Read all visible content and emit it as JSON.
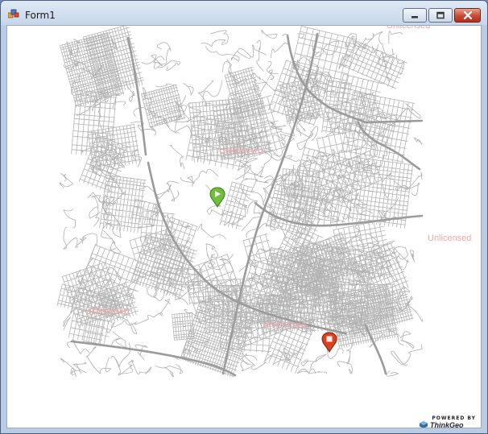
{
  "window": {
    "title": "Form1",
    "controls": {
      "minimize": "minimize",
      "maximize": "maximize",
      "close": "close"
    }
  },
  "map": {
    "watermark_text": "Unlicensed",
    "markers": [
      {
        "name": "start-marker",
        "color": "#6fbf3a",
        "icon": "play-flag-icon"
      },
      {
        "name": "end-marker",
        "color": "#d9421e",
        "icon": "stop-square-icon"
      }
    ],
    "road_color": "#a9a9a9",
    "highway_color": "#9b9b9b"
  },
  "branding": {
    "powered_by": "POWERED BY",
    "company": "ThinkGeo"
  }
}
